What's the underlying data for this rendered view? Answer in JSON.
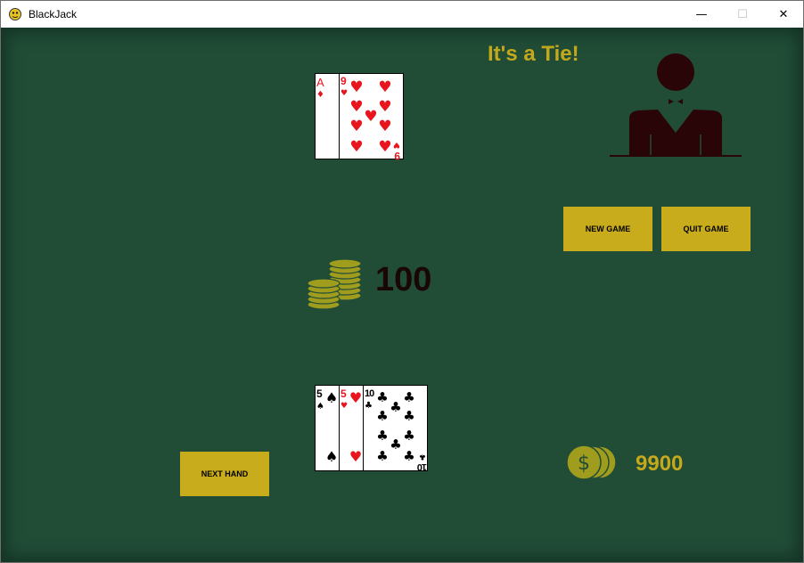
{
  "window": {
    "title": "BlackJack",
    "controls": {
      "minimize": "—",
      "maximize": "☐",
      "close": "✕"
    }
  },
  "status": {
    "message": "It's a Tie!"
  },
  "buttons": {
    "new_game": "NEW GAME",
    "quit_game": "QUIT GAME",
    "next_hand": "NEXT HAND"
  },
  "bet": {
    "amount": "100"
  },
  "bank": {
    "amount": "9900",
    "coin_symbol": "$"
  },
  "dealer_hand": [
    {
      "rank": "A",
      "suit": "♦"
    },
    {
      "rank": "9",
      "suit": "♥"
    }
  ],
  "player_hand": [
    {
      "rank": "5",
      "suit": "♠"
    },
    {
      "rank": "5",
      "suit": "♥"
    },
    {
      "rank": "10",
      "suit": "♣"
    }
  ],
  "colors": {
    "table": "#214d37",
    "accent": "#c8ac1c",
    "red_suit": "#e8141e",
    "black_suit": "#000000",
    "dealer": "#2a0508"
  }
}
